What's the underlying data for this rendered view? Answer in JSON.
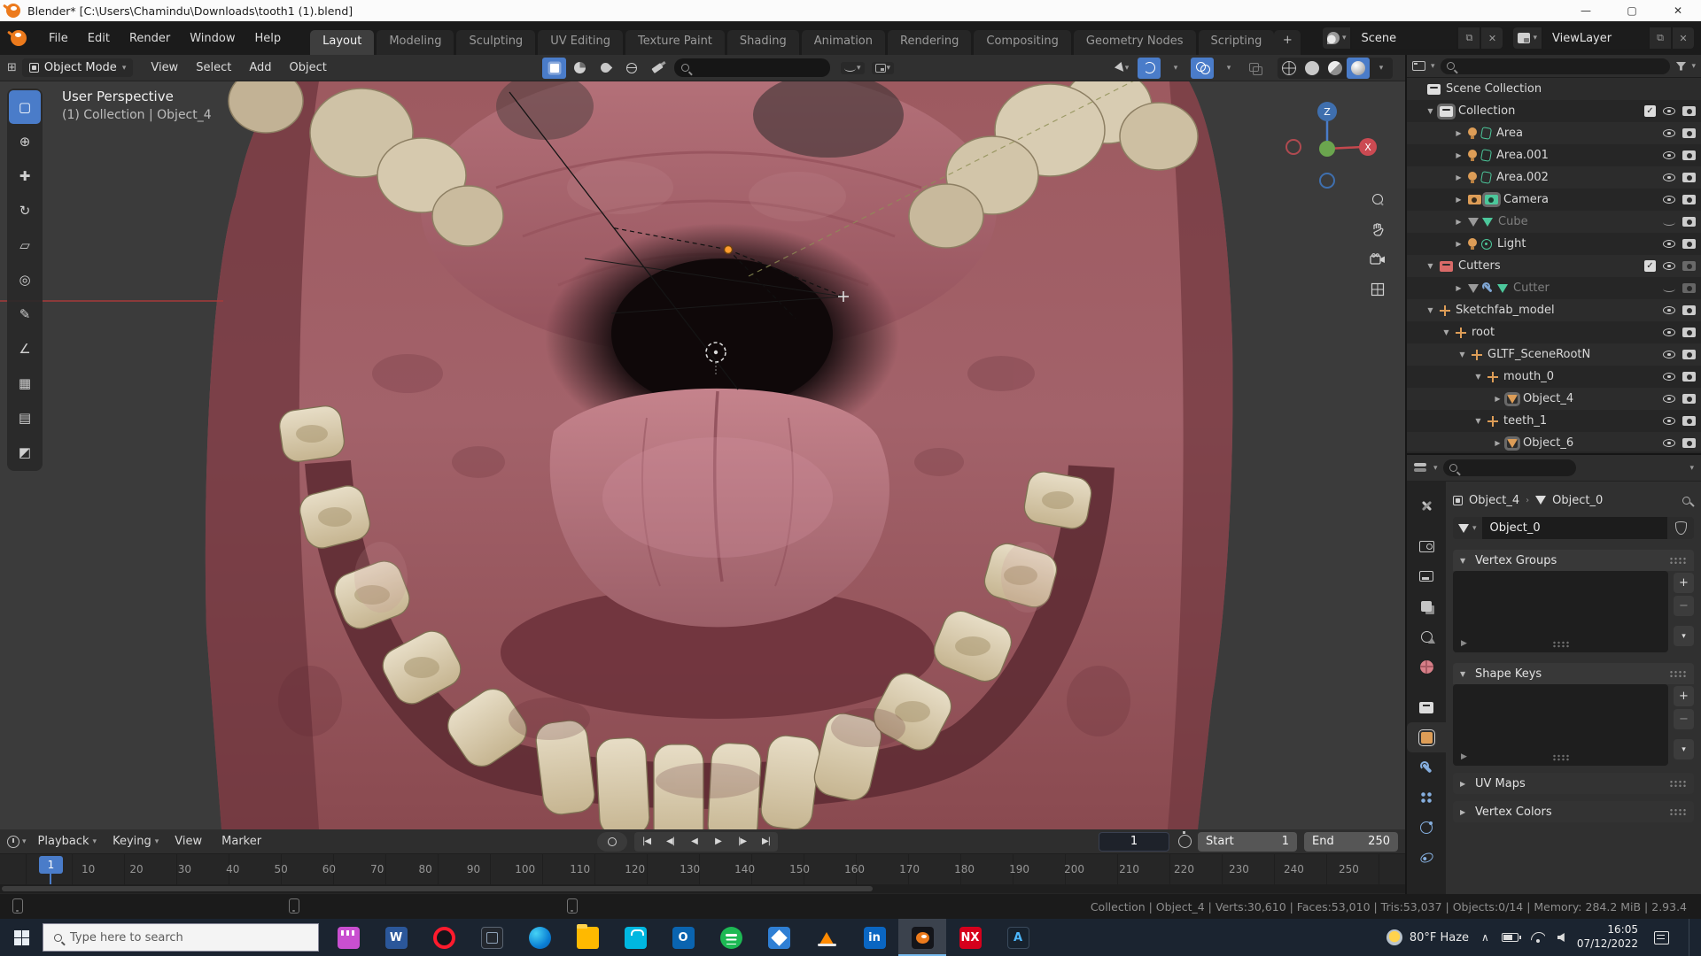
{
  "window": {
    "title": "Blender* [C:\\Users\\Chamindu\\Downloads\\tooth1 (1).blend]",
    "minimize": "—",
    "maximize": "▢",
    "close": "✕"
  },
  "topbar": {
    "menus": [
      "File",
      "Edit",
      "Render",
      "Window",
      "Help"
    ],
    "tabs": [
      {
        "label": "Layout",
        "cls": "active"
      },
      {
        "label": "Modeling"
      },
      {
        "label": "Sculpting"
      },
      {
        "label": "UV Editing"
      },
      {
        "label": "Texture Paint"
      },
      {
        "label": "Shading"
      },
      {
        "label": "Animation"
      },
      {
        "label": "Rendering"
      },
      {
        "label": "Compositing"
      },
      {
        "label": "Geometry Nodes"
      },
      {
        "label": "Scripting"
      }
    ],
    "new_tab": "+",
    "scene_label": "Scene",
    "viewlayer_label": "ViewLayer"
  },
  "viewport": {
    "mode": "Object Mode",
    "menus": [
      "View",
      "Select",
      "Add",
      "Object"
    ],
    "overlay_line1": "User Perspective",
    "overlay_line2": "(1) Collection | Object_4",
    "axis_x": "X",
    "axis_z": "Z"
  },
  "tools": [
    {
      "name": "select-box",
      "g": "▢",
      "cls": "active"
    },
    {
      "name": "cursor",
      "g": "⊕"
    },
    {
      "name": "move",
      "g": "✚"
    },
    {
      "name": "rotate",
      "g": "↻"
    },
    {
      "name": "scale",
      "g": "▱"
    },
    {
      "name": "transform",
      "g": "◎"
    },
    {
      "name": "annotate",
      "g": "✎"
    },
    {
      "name": "measure",
      "g": "∠"
    },
    {
      "name": "add-cube",
      "g": "▦"
    },
    {
      "name": "mesh-extra",
      "g": "▤"
    },
    {
      "name": "region",
      "g": "◩"
    }
  ],
  "outliner": {
    "rows": [
      {
        "ind": "6px",
        "exp": "",
        "icon": "oi-box",
        "label": "Scene Collection"
      },
      {
        "ind": "20px",
        "exp": "▼",
        "icon": "oi-box acth",
        "label": "Collection",
        "chk": "chk-on",
        "eye": "eye-open",
        "cam": "cam-on"
      },
      {
        "ind": "52px",
        "exp": "▶",
        "icon": "oi-bulb",
        "icon2": "oi-ldata",
        "label": "Area",
        "eye": "eye-open",
        "cam": "cam-on"
      },
      {
        "ind": "52px",
        "exp": "▶",
        "icon": "oi-bulb",
        "icon2": "oi-ldata",
        "label": "Area.001",
        "eye": "eye-open",
        "cam": "cam-on"
      },
      {
        "ind": "52px",
        "exp": "▶",
        "icon": "oi-bulb",
        "icon2": "oi-ldata",
        "label": "Area.002",
        "eye": "eye-open",
        "cam": "cam-on"
      },
      {
        "ind": "52px",
        "exp": "▶",
        "icon": "oi-cam",
        "icon2": "oi-cam green acth",
        "label": "Camera",
        "eye": "eye-open",
        "cam": "cam-on"
      },
      {
        "ind": "52px",
        "exp": "▶",
        "icon": "oi-mesh gray",
        "icon2": "oi-mesh green",
        "label": "Cube",
        "cls": "grayed",
        "eye": "eye-closed",
        "cam": "cam-on"
      },
      {
        "ind": "52px",
        "exp": "▶",
        "icon": "oi-bulb",
        "icon2": "oi-plight",
        "label": "Light",
        "eye": "eye-open",
        "cam": "cam-on"
      },
      {
        "ind": "20px",
        "exp": "▼",
        "icon": "oi-box red",
        "label": "Cutters",
        "chk": "chk-on",
        "eye": "eye-open",
        "cam": "cam-x"
      },
      {
        "ind": "52px",
        "exp": "▶",
        "icon": "oi-mesh gray",
        "icon2": "oi-wrench",
        "icon3": "oi-mesh green",
        "label": "Cutter",
        "cls": "grayed",
        "eye": "eye-closed",
        "cam": "cam-x"
      },
      {
        "ind": "20px",
        "exp": "▼",
        "icon": "oi-axes",
        "label": "Sketchfab_model",
        "eye": "eye-open",
        "cam": "cam-on"
      },
      {
        "ind": "38px",
        "exp": "▼",
        "icon": "oi-axes",
        "label": "root",
        "eye": "eye-open",
        "cam": "cam-on"
      },
      {
        "ind": "56px",
        "exp": "▼",
        "icon": "oi-axes",
        "label": "GLTF_SceneRootN",
        "eye": "eye-open",
        "cam": "cam-on"
      },
      {
        "ind": "74px",
        "exp": "▼",
        "icon": "oi-axes",
        "label": "mouth_0",
        "eye": "eye-open",
        "cam": "cam-on"
      },
      {
        "ind": "96px",
        "exp": "▶",
        "icon": "oi-mesh sel",
        "label": "Object_4",
        "eye": "eye-open",
        "cam": "cam-on"
      },
      {
        "ind": "74px",
        "exp": "▼",
        "icon": "oi-axes",
        "label": "teeth_1",
        "eye": "eye-open",
        "cam": "cam-on"
      },
      {
        "ind": "96px",
        "exp": "▶",
        "icon": "oi-mesh sel",
        "label": "Object_6",
        "eye": "eye-open",
        "cam": "cam-on"
      }
    ]
  },
  "properties": {
    "tabs": [
      {
        "name": "tool",
        "ic": "pt-tool"
      },
      {
        "name": "render",
        "ic": "pt-render",
        "cls": "gap"
      },
      {
        "name": "output",
        "ic": "pt-output"
      },
      {
        "name": "view-layer",
        "ic": "pt-viewlayer"
      },
      {
        "name": "scene",
        "ic": "pt-scene"
      },
      {
        "name": "world",
        "ic": "pt-world"
      },
      {
        "name": "collection",
        "ic": "pt-collection",
        "cls": "gap"
      },
      {
        "name": "object",
        "ic": "pt-object",
        "cls": "active"
      },
      {
        "name": "modifiers",
        "ic": "pt-modifiers"
      },
      {
        "name": "particles",
        "ic": "pt-particles"
      },
      {
        "name": "physics",
        "ic": "pt-physics"
      },
      {
        "name": "constraints",
        "ic": "pt-constraints"
      }
    ],
    "breadcrumb_object": "Object_4",
    "breadcrumb_sep": "›",
    "breadcrumb_data": "Object_0",
    "name_value": "Object_0",
    "vertex_groups_label": "Vertex Groups",
    "shape_keys_label": "Shape Keys",
    "uv_maps_label": "UV Maps",
    "vertex_colors_label": "Vertex Colors",
    "add_label": "+",
    "remove_label": "−",
    "specials_chevron": "▾",
    "expanded_glyph": "▼",
    "collapsed_glyph": "▶"
  },
  "timeline": {
    "menus": [
      {
        "label": "Playback",
        "chev": "▾"
      },
      {
        "label": "Keying",
        "chev": "▾"
      },
      {
        "label": "View"
      },
      {
        "label": "Marker"
      }
    ],
    "transport": [
      {
        "name": "jump-to-start",
        "g": "|◀"
      },
      {
        "name": "prev-keyframe",
        "g": "◀|"
      },
      {
        "name": "play-reverse",
        "g": "◀"
      },
      {
        "name": "play",
        "g": "▶"
      },
      {
        "name": "next-keyframe",
        "g": "|▶"
      },
      {
        "name": "jump-to-end",
        "g": "▶|"
      }
    ],
    "current_frame": "1",
    "playhead": "1",
    "start_label": "Start",
    "start_value": "1",
    "end_label": "End",
    "end_value": "250",
    "ticks": [
      "10",
      "20",
      "30",
      "40",
      "50",
      "60",
      "70",
      "80",
      "90",
      "100",
      "110",
      "120",
      "130",
      "140",
      "150",
      "160",
      "170",
      "180",
      "190",
      "200",
      "210",
      "220",
      "230",
      "240",
      "250"
    ]
  },
  "statusbar": {
    "text": "Collection | Object_4 | Verts:30,610 | Faces:53,010 | Tris:53,037 | Objects:0/14 | Memory: 284.2 MiB | 2.93.4"
  },
  "taskbar": {
    "search_placeholder": "Type here to search",
    "apps": [
      {
        "name": "movie-maker",
        "ic": "ic-mm"
      },
      {
        "name": "word",
        "ic": "ic-word",
        "t": "W"
      },
      {
        "name": "opera",
        "ic": "ic-opera"
      },
      {
        "name": "capture-app",
        "ic": "ic-cap"
      },
      {
        "name": "edge",
        "ic": "ic-edge"
      },
      {
        "name": "file-explorer",
        "ic": "ic-exp"
      },
      {
        "name": "store",
        "ic": "ic-store"
      },
      {
        "name": "outlook",
        "ic": "ic-outlook",
        "t": "O"
      },
      {
        "name": "spotify",
        "ic": "ic-spotify"
      },
      {
        "name": "photos",
        "ic": "ic-photos"
      },
      {
        "name": "vlc",
        "ic": "ic-vlc"
      },
      {
        "name": "linkedin",
        "ic": "ic-li",
        "t": "in"
      },
      {
        "name": "blender",
        "ic": "ic-blender",
        "cls": "active"
      },
      {
        "name": "nx",
        "ic": "ic-nx",
        "t": "NX"
      },
      {
        "name": "cad-app",
        "ic": "ic-cad",
        "t": "A"
      }
    ],
    "weather": "80°F Haze",
    "time": "16:05",
    "date": "07/12/2022"
  }
}
